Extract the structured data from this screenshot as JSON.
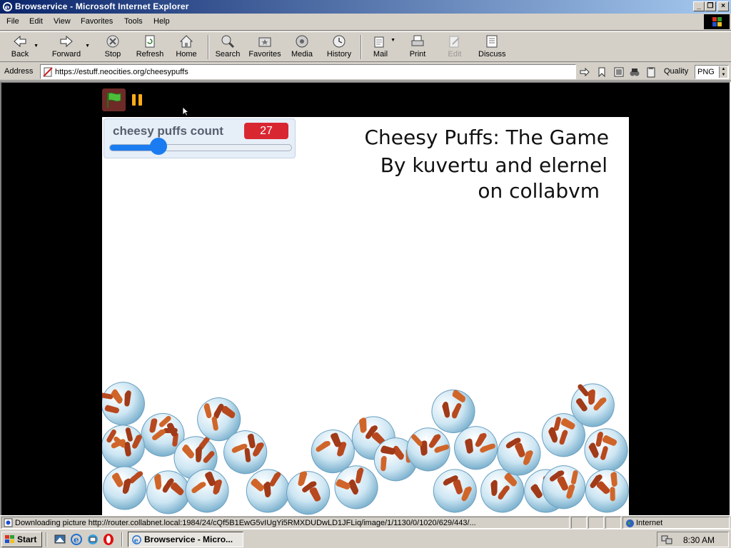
{
  "window": {
    "title": "Browservice - Microsoft Internet Explorer"
  },
  "menu": [
    "File",
    "Edit",
    "View",
    "Favorites",
    "Tools",
    "Help"
  ],
  "toolbar": {
    "back": "Back",
    "forward": "Forward",
    "stop": "Stop",
    "refresh": "Refresh",
    "home": "Home",
    "search": "Search",
    "favorites": "Favorites",
    "media": "Media",
    "history": "History",
    "mail": "Mail",
    "print": "Print",
    "edit": "Edit",
    "discuss": "Discuss"
  },
  "address": {
    "label": "Address",
    "url": "https://estuff.neocities.org/cheesypuffs"
  },
  "quality": {
    "label": "Quality",
    "value": "PNG"
  },
  "game": {
    "variable_label": "cheesy puffs count",
    "variable_value": "27",
    "slider_fraction": 0.27,
    "title_lines": [
      "Cheesy Puffs: The Game",
      "By kuvertu and elernel",
      "on collabvm"
    ]
  },
  "status": {
    "message": "Downloading picture http://router.collabnet.local:1984/24/cQf5B1EwG5vIUgYi5RMXDUDwLD1JFLiq/image/1/1130/0/1020/629/443/...",
    "zone": "Internet"
  },
  "taskbar": {
    "start": "Start",
    "task": "Browservice - Micro...",
    "clock": "8:30 AM"
  }
}
